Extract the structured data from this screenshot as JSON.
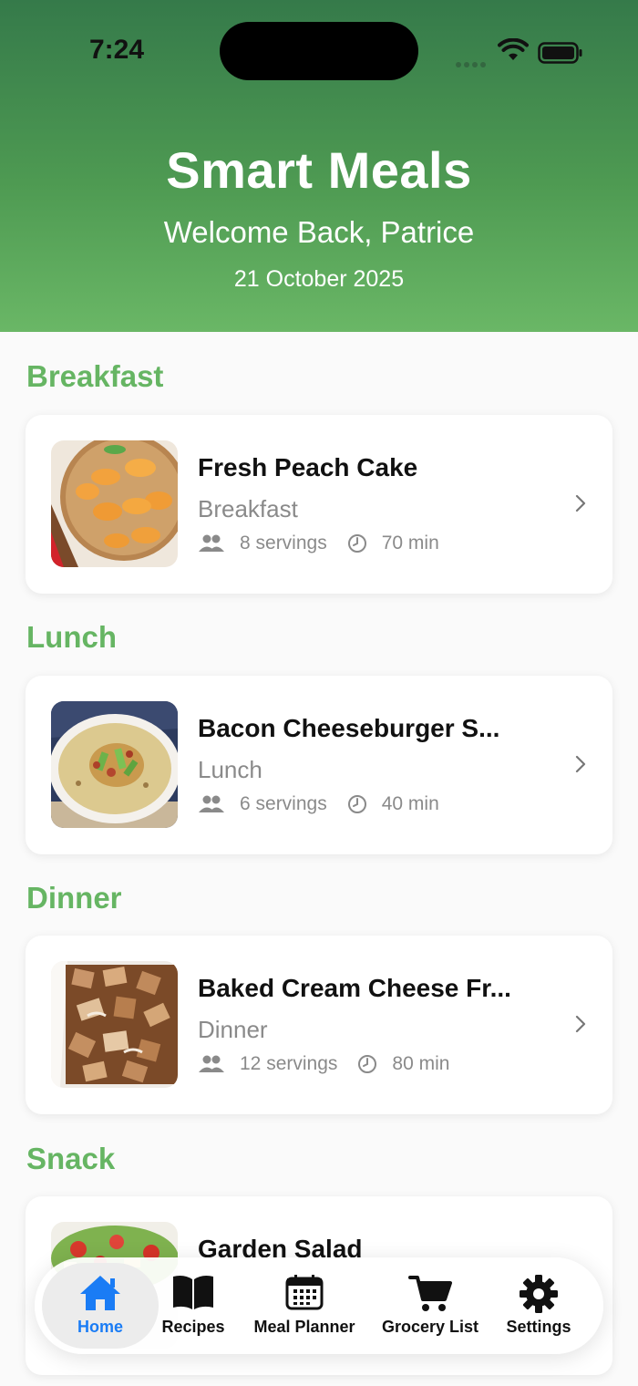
{
  "status_bar": {
    "time": "7:24"
  },
  "header": {
    "title": "Smart Meals",
    "welcome": "Welcome Back, Patrice",
    "date": "21 October 2025"
  },
  "sections": [
    {
      "title": "Breakfast",
      "recipe": {
        "name": "Fresh Peach Cake",
        "category": "Breakfast",
        "servings": "8 servings",
        "time": "70 min"
      }
    },
    {
      "title": "Lunch",
      "recipe": {
        "name": "Bacon Cheeseburger S...",
        "category": "Lunch",
        "servings": "6 servings",
        "time": "40 min"
      }
    },
    {
      "title": "Dinner",
      "recipe": {
        "name": "Baked Cream Cheese Fr...",
        "category": "Dinner",
        "servings": "12 servings",
        "time": "80 min"
      }
    },
    {
      "title": "Snack",
      "recipe": {
        "name": "Garden Salad"
      }
    }
  ],
  "tabs": [
    {
      "label": "Home",
      "icon": "house-icon",
      "active": true
    },
    {
      "label": "Recipes",
      "icon": "book-icon",
      "active": false
    },
    {
      "label": "Meal Planner",
      "icon": "calendar-icon",
      "active": false
    },
    {
      "label": "Grocery List",
      "icon": "cart-icon",
      "active": false
    },
    {
      "label": "Settings",
      "icon": "gear-icon",
      "active": false
    }
  ],
  "colors": {
    "header_top": "#357a4a",
    "header_bottom": "#6ab766",
    "section_title": "#66b563",
    "active_tab": "#1a7cf5"
  }
}
